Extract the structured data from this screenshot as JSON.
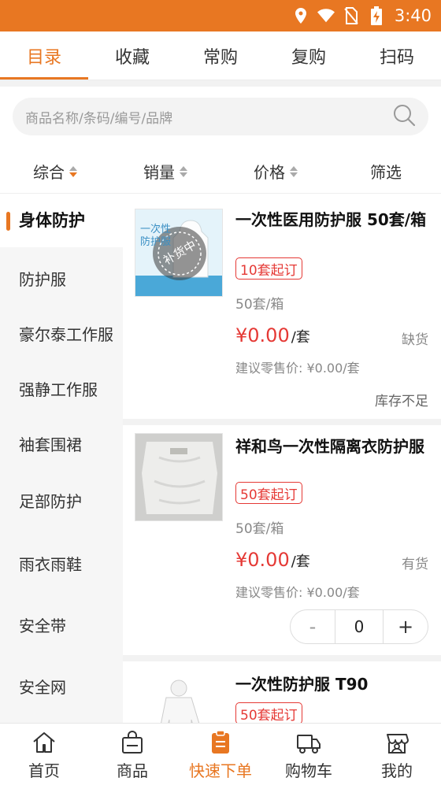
{
  "status": {
    "time": "3:40",
    "icons": [
      "location-icon",
      "wifi-icon",
      "no-sim-icon",
      "battery-charging-icon"
    ],
    "color": "#e87722"
  },
  "tabs": [
    {
      "label": "目录",
      "active": true
    },
    {
      "label": "收藏"
    },
    {
      "label": "常购"
    },
    {
      "label": "复购"
    },
    {
      "label": "扫码"
    }
  ],
  "search": {
    "placeholder": "商品名称/条码/编号/品牌"
  },
  "sort": {
    "comprehensive": "综合",
    "sales": "销量",
    "price": "价格",
    "filter": "筛选"
  },
  "sidebar": {
    "items": [
      {
        "label": "身体防护",
        "active": true
      },
      {
        "label": "防护服"
      },
      {
        "label": "豪尔泰工作服"
      },
      {
        "label": "强静工作服"
      },
      {
        "label": "袖套围裙"
      },
      {
        "label": "足部防护"
      },
      {
        "label": "雨衣雨鞋"
      },
      {
        "label": "安全带"
      },
      {
        "label": "安全网"
      }
    ]
  },
  "products": [
    {
      "name": "一次性医用防护服 50套/箱",
      "badge": "10套起订",
      "spec": "50套/箱",
      "price": "¥0.00",
      "unit": "/套",
      "stock": "缺货",
      "retail": "建议零售价: ¥0.00/套",
      "note": "库存不足",
      "overlay": "补货中",
      "thumb_text": "一次性防护服"
    },
    {
      "name": "祥和鸟一次性隔离衣防护服",
      "badge": "50套起订",
      "spec": "50套/箱",
      "price": "¥0.00",
      "unit": "/套",
      "stock": "有货",
      "retail": "建议零售价: ¥0.00/套",
      "quantity": "0",
      "minus": "-",
      "plus": "+"
    },
    {
      "name": "一次性防护服 T90",
      "badge": "50套起订"
    }
  ],
  "bottom_nav": [
    {
      "label": "首页",
      "icon": "home-icon"
    },
    {
      "label": "商品",
      "icon": "bag-icon"
    },
    {
      "label": "快速下单",
      "icon": "clipboard-icon",
      "active": true
    },
    {
      "label": "购物车",
      "icon": "truck-icon"
    },
    {
      "label": "我的",
      "icon": "store-user-icon"
    }
  ]
}
